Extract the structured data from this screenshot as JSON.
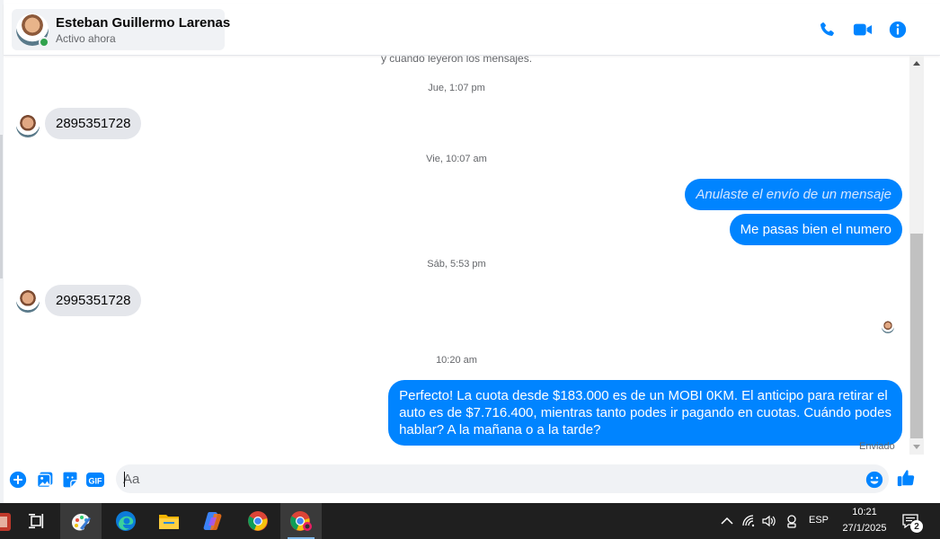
{
  "header": {
    "contact_name": "Esteban Guillermo Larenas",
    "contact_status": "Activo ahora",
    "actions": [
      "phone-icon",
      "video-camera-icon",
      "info-icon"
    ]
  },
  "colors": {
    "accent": "#0084ff",
    "received_bubble": "#e4e6eb",
    "online": "#31a24c",
    "taskbar": "#1f1f1f"
  },
  "conversation": {
    "notice": "y cuando leyeron los mensajes.",
    "timestamps": [
      "Jue, 1:07 pm",
      "Vie, 10:07 am",
      "Sáb, 5:53 pm",
      "10:20 am"
    ],
    "messages": [
      {
        "from": "contact",
        "text": "2895351728"
      },
      {
        "from": "me",
        "text": "Anulaste el envío de un mensaje",
        "unsent": true
      },
      {
        "from": "me",
        "text": "Me pasas bien el numero"
      },
      {
        "from": "contact",
        "text": "2995351728"
      },
      {
        "from": "me",
        "lines": [
          "Perfecto! La cuota desde $183.000 es de un MOBI 0KM. El anticipo para retirar el",
          "auto es de $7.716.400, mientras tanto podes ir pagando en cuotas. Cuándo podes",
          "hablar? A la mañana o a la tarde?"
        ]
      }
    ],
    "delivery_status": "Enviado"
  },
  "composer": {
    "placeholder": "Aa",
    "gif_label": "GIF"
  },
  "taskbar": {
    "apps": [
      "task-view-icon",
      "paint-app-icon",
      "edge-icon",
      "file-explorer-icon",
      "copilot-icon",
      "chrome-icon",
      "chrome-profile-icon"
    ],
    "language": "ESP",
    "time": "10:21",
    "date": "27/1/2025",
    "notification_count": "2"
  }
}
